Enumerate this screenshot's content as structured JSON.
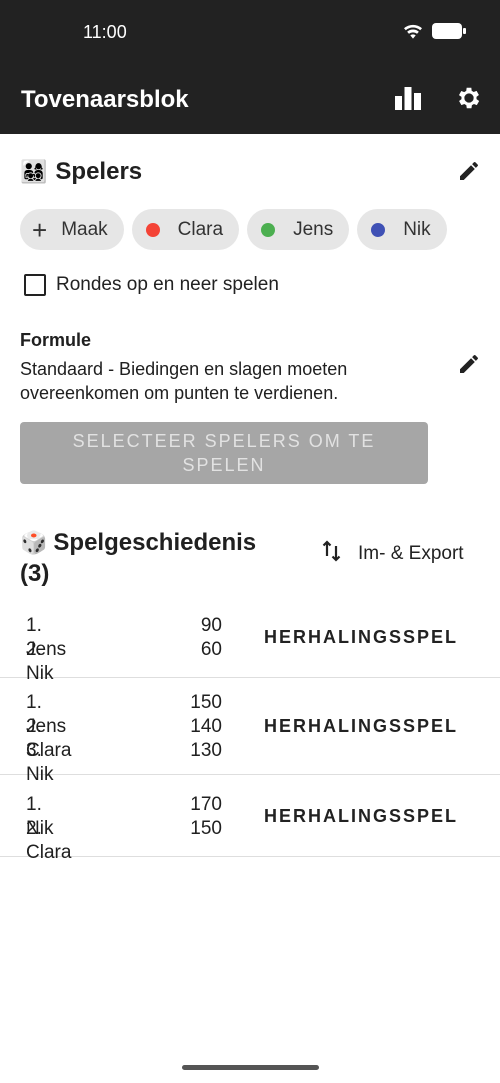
{
  "status_bar": {
    "time": "11:00"
  },
  "app_bar": {
    "title": "Tovenaarsblok",
    "stats_icon": "bar-chart-icon",
    "settings_icon": "gear-icon"
  },
  "players": {
    "emoji": "👨‍👩‍👧‍👦",
    "heading": "Spelers",
    "add_label": "Maak",
    "chips": [
      {
        "name": "Clara",
        "color": "#f44336"
      },
      {
        "name": "Jens",
        "color": "#4caf50"
      },
      {
        "name": "Nik",
        "color": "#3f51b5"
      }
    ],
    "rounds_checkbox_label": "Rondes op en neer spelen",
    "rounds_checked": false
  },
  "formula": {
    "label": "Formule",
    "description": "Standaard - Biedingen en slagen moeten overeenkomen om punten te verdienen."
  },
  "select_button_label": "SELECTEER SPELERS OM TE SPELEN",
  "history": {
    "emoji": "🎲",
    "title": "Spelgeschiedenis",
    "count": "(3)",
    "export_label": "Im- & Export",
    "replay_label": "HERHALINGSSPEL",
    "games": [
      {
        "ranks": [
          {
            "pos": "1. Jens",
            "score": "90"
          },
          {
            "pos": "2. Nik",
            "score": "60"
          }
        ]
      },
      {
        "ranks": [
          {
            "pos": "1. Jens",
            "score": "150"
          },
          {
            "pos": "2. Clara",
            "score": "140"
          },
          {
            "pos": "3. Nik",
            "score": "130"
          }
        ]
      },
      {
        "ranks": [
          {
            "pos": "1. Nik",
            "score": "170"
          },
          {
            "pos": "2. Clara",
            "score": "150"
          }
        ]
      }
    ]
  }
}
